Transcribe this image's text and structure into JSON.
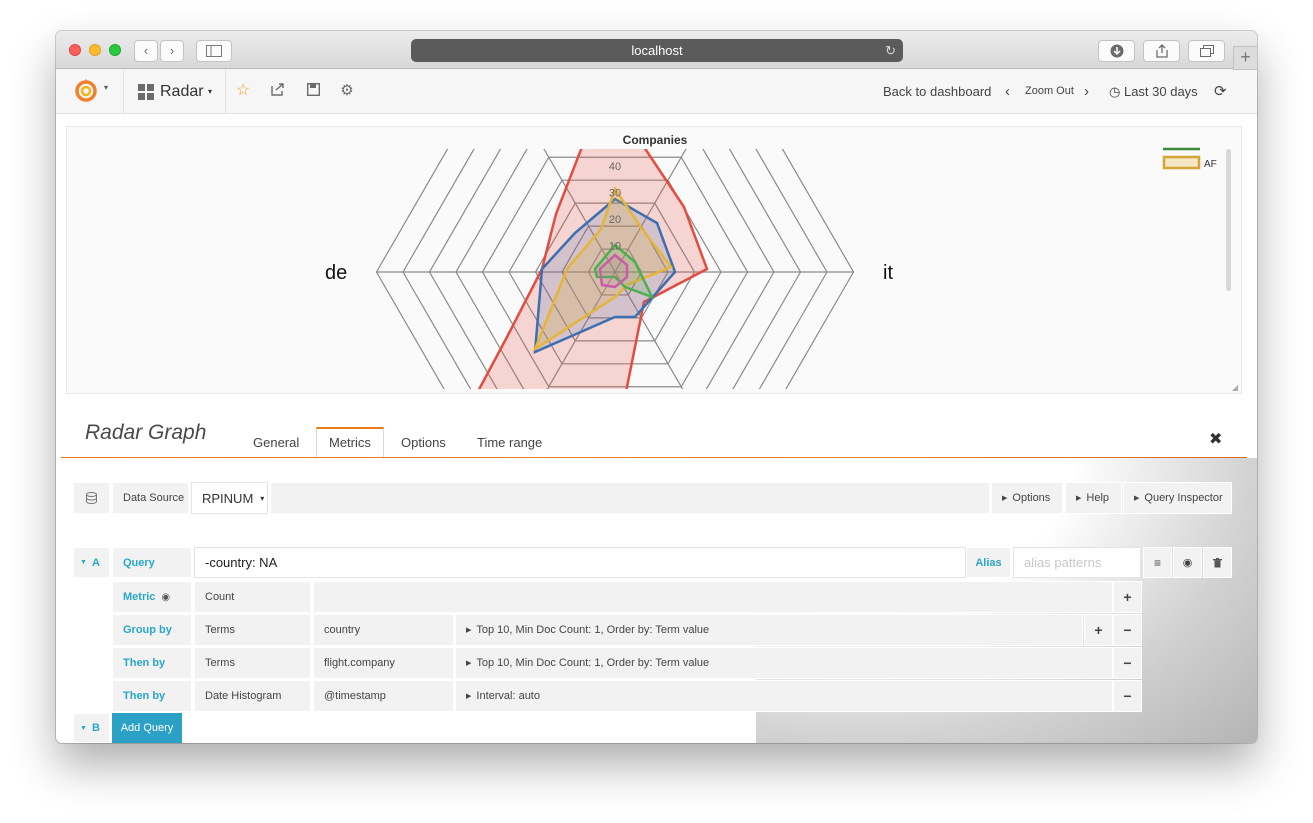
{
  "browser": {
    "url": "localhost"
  },
  "navbar": {
    "dashboard_name": "Radar",
    "back_label": "Back to dashboard",
    "zoom_out_label": "Zoom Out",
    "time_range_label": "Last 30 days"
  },
  "chart_data": {
    "type": "radar",
    "title": "Companies",
    "axis_labels": [
      "de",
      "it"
    ],
    "ticks": [
      "10",
      "20",
      "30",
      "40"
    ],
    "legend": [
      {
        "name": "",
        "color": "#3d8c3d"
      },
      {
        "name": "AF",
        "color": "#d3a637"
      }
    ],
    "colors": {
      "red": "#e24d42",
      "blue": "#3b6fb0",
      "yellow": "#e5b538",
      "green": "#4caf50"
    }
  },
  "editor": {
    "title": "Radar Graph",
    "tabs": [
      {
        "label": "General"
      },
      {
        "label": "Metrics"
      },
      {
        "label": "Options"
      },
      {
        "label": "Time range"
      }
    ],
    "active_tab": "Metrics",
    "datasource_label": "Data Source",
    "datasource_value": "RPINUM",
    "toolbar": {
      "options": "Options",
      "help": "Help",
      "query_inspector": "Query Inspector"
    },
    "query": {
      "ref": "A",
      "label": "Query",
      "value": "-country: NA",
      "alias_label": "Alias",
      "alias_placeholder": "alias patterns"
    },
    "metric": {
      "label": "Metric",
      "value": "Count"
    },
    "buckets": [
      {
        "label": "Group by",
        "type": "Terms",
        "field": "country",
        "settings": "Top 10, Min Doc Count: 1, Order by: Term value"
      },
      {
        "label": "Then by",
        "type": "Terms",
        "field": "flight.company",
        "settings": "Top 10, Min Doc Count: 1, Order by: Term value"
      },
      {
        "label": "Then by",
        "type": "Date Histogram",
        "field": "@timestamp",
        "settings": "Interval: auto"
      }
    ],
    "next_ref": "B",
    "add_query_label": "Add Query"
  }
}
